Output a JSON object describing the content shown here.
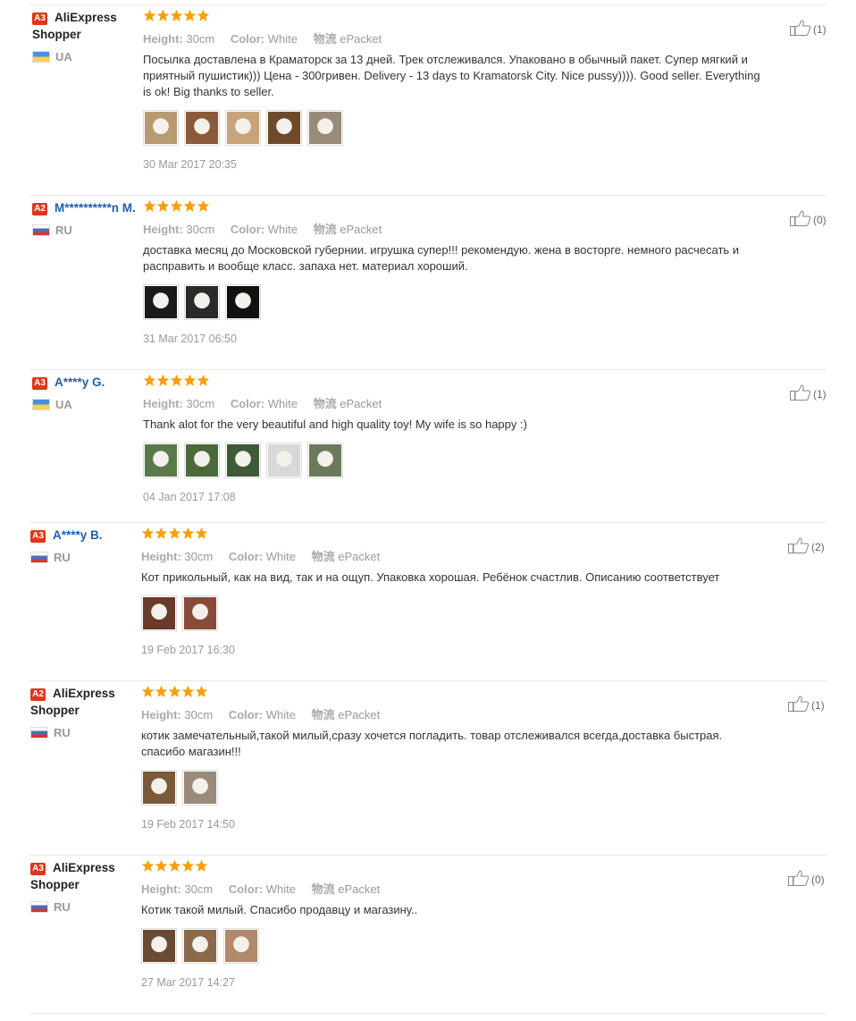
{
  "reviews": [
    {
      "level": "A3",
      "user": "AliExpress Shopper",
      "user_color": "black",
      "country": "UA",
      "flag": "ua",
      "rating": 5,
      "attrs": {
        "height_label": "Height:",
        "height_value": "30cm",
        "color_label": "Color:",
        "color_value": "White",
        "ship_label": "物流",
        "ship_value": "ePacket"
      },
      "text": "Посылка доставлена в Краматорск за 13 дней. Трек отслеживался. Упаковано в обычный пакет. Супер мягкий и приятный пушистик))) Цена - 300гривен. Delivery - 13 days to Kramatorsk City. Nice pussy)))). Good seller. Everything is ok! Big thanks to seller.",
      "photo_count": 5,
      "date": "30 Mar 2017 20:35",
      "likes": "(1)"
    },
    {
      "level": "A2",
      "user": "M**********n M.",
      "user_color": "blue",
      "country": "RU",
      "flag": "ru",
      "rating": 5,
      "attrs": {
        "height_label": "Height:",
        "height_value": "30cm",
        "color_label": "Color:",
        "color_value": "White",
        "ship_label": "物流",
        "ship_value": "ePacket"
      },
      "text": "доставка месяц до Московской губернии. игрушка супер!!! рекомендую. жена в восторге. немного расчесать и расправить и вообще класс. запаха нет. материал хороший.",
      "photo_count": 3,
      "date": "31 Mar 2017 06:50",
      "likes": "(0)"
    },
    {
      "level": "A3",
      "user": "A****y G.",
      "user_color": "blue",
      "country": "UA",
      "flag": "ua",
      "rating": 5,
      "attrs": {
        "height_label": "Height:",
        "height_value": "30cm",
        "color_label": "Color:",
        "color_value": "White",
        "ship_label": "物流",
        "ship_value": "ePacket"
      },
      "text": "Thank alot for the very beautiful and high quality toy! My wife is so happy :)",
      "photo_count": 5,
      "date": "04 Jan 2017 17:08",
      "likes": "(1)"
    },
    {
      "level": "A3",
      "user": "A****y B.",
      "user_color": "blue",
      "country": "RU",
      "flag": "ru",
      "rating": 5,
      "attrs": {
        "height_label": "Height:",
        "height_value": "30cm",
        "color_label": "Color:",
        "color_value": "White",
        "ship_label": "物流",
        "ship_value": "ePacket"
      },
      "text": "Кот прикольный, как на вид, так и на ощуп. Упаковка хорошая. Ребёнок счастлив. Описанию соответствует",
      "photo_count": 2,
      "date": "19 Feb 2017 16:30",
      "likes": "(2)"
    },
    {
      "level": "A2",
      "user": "AliExpress Shopper",
      "user_color": "black",
      "country": "RU",
      "flag": "ru",
      "rating": 5,
      "attrs": {
        "height_label": "Height:",
        "height_value": "30cm",
        "color_label": "Color:",
        "color_value": "White",
        "ship_label": "物流",
        "ship_value": "ePacket"
      },
      "text": "котик замечательный,такой милый,сразу хочется погладить. товар отслеживался всегда,доставка быстрая. спасибо магазин!!!",
      "photo_count": 2,
      "date": "19 Feb 2017 14:50",
      "likes": "(1)"
    },
    {
      "level": "A3",
      "user": "AliExpress Shopper",
      "user_color": "black",
      "country": "RU",
      "flag": "ru",
      "rating": 5,
      "attrs": {
        "height_label": "Height:",
        "height_value": "30cm",
        "color_label": "Color:",
        "color_value": "White",
        "ship_label": "物流",
        "ship_value": "ePacket"
      },
      "text": "Котик такой милый. Спасибо продавцу и магазину..",
      "photo_count": 3,
      "date": "27 Mar 2017 14:27",
      "likes": "(0)"
    }
  ],
  "colors": {
    "star": "#f5a00a",
    "level_badge": "#e0361a",
    "user_blue": "#1f5fad"
  }
}
